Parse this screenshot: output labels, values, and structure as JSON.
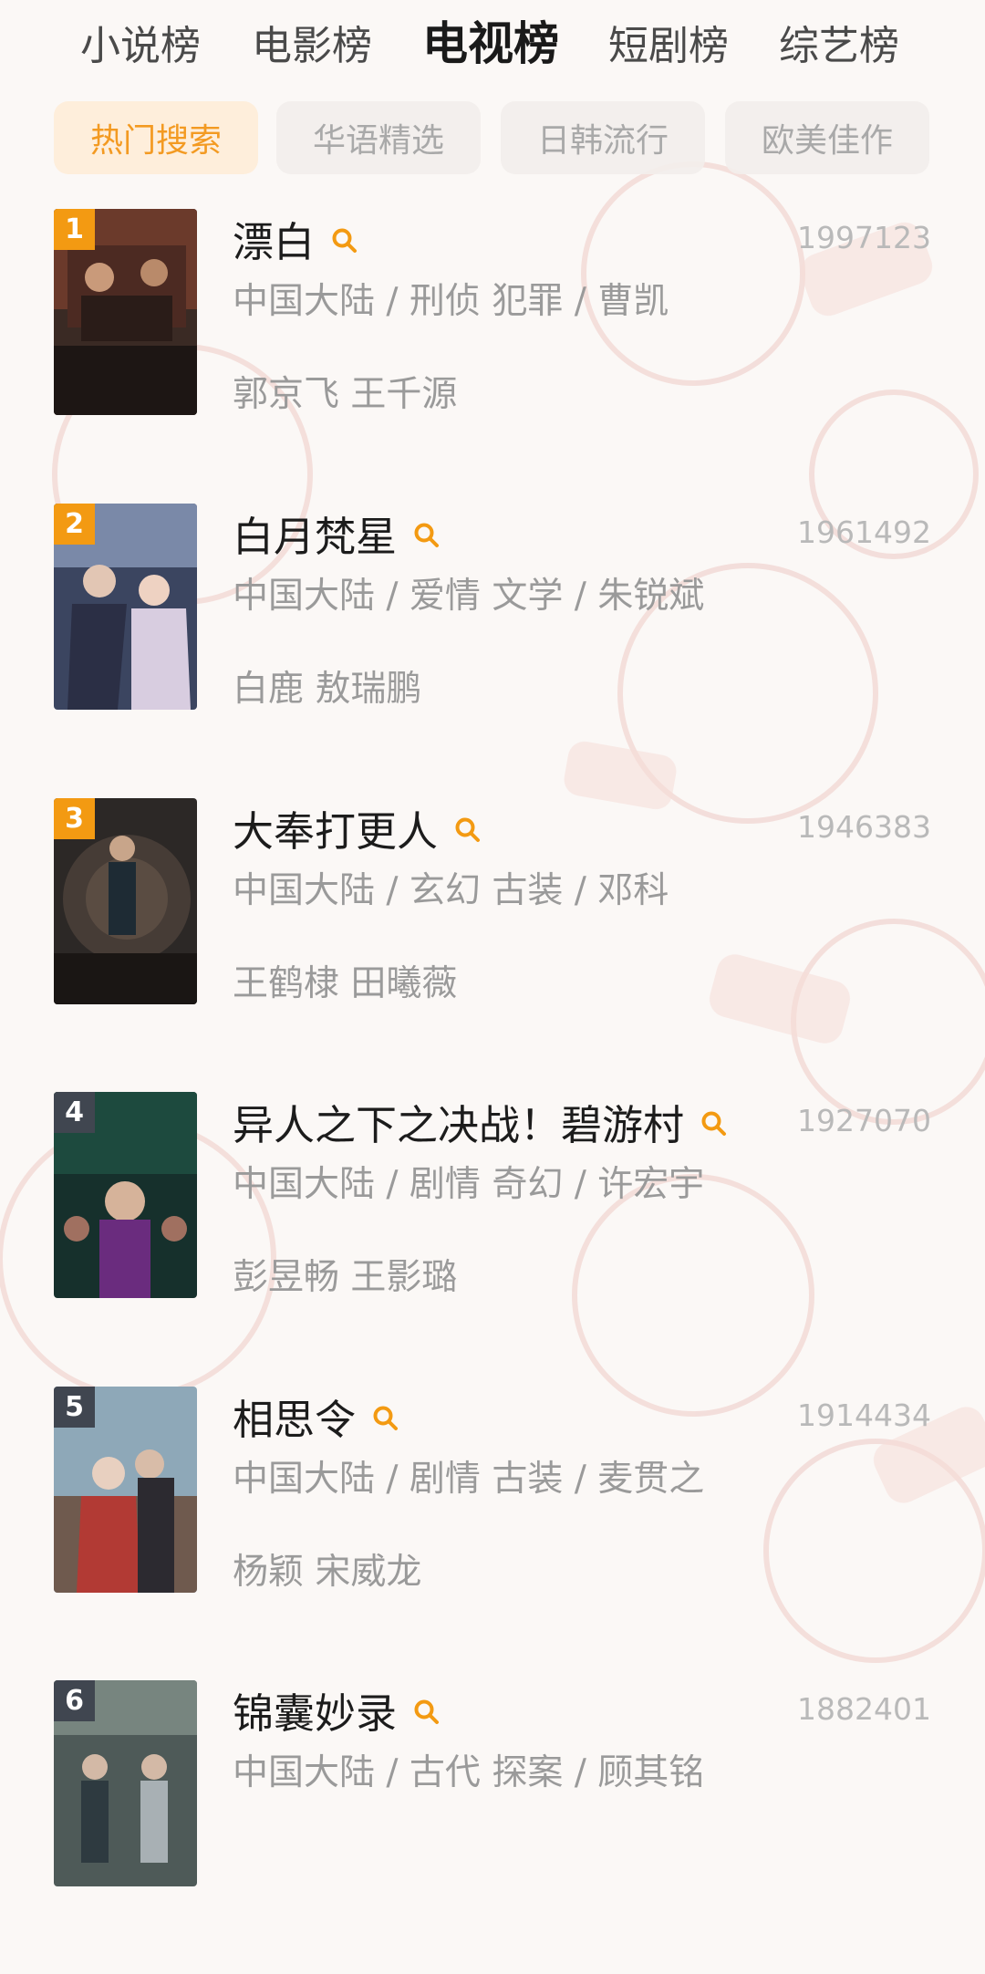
{
  "top_tabs": [
    {
      "label": "小说榜",
      "active": false
    },
    {
      "label": "电影榜",
      "active": false
    },
    {
      "label": "电视榜",
      "active": true
    },
    {
      "label": "短剧榜",
      "active": false
    },
    {
      "label": "综艺榜",
      "active": false
    }
  ],
  "sub_tabs": [
    {
      "label": "热门搜索",
      "active": true
    },
    {
      "label": "华语精选",
      "active": false
    },
    {
      "label": "日韩流行",
      "active": false
    },
    {
      "label": "欧美佳作",
      "active": false
    }
  ],
  "colors": {
    "accent": "#f39a12",
    "accent_text": "#f39a22",
    "rank_dark": "#404650"
  },
  "search_icon": "search-icon",
  "items": [
    {
      "rank": "1",
      "title": "漂白",
      "score": "1997123",
      "meta": "中国大陆 / 刑侦 犯罪 / 曹凯",
      "cast": "郭京飞 王千源",
      "poster_title": "漂白"
    },
    {
      "rank": "2",
      "title": "白月梵星",
      "score": "1961492",
      "meta": "中国大陆 / 爱情 文学 / 朱锐斌",
      "cast": "白鹿 敖瑞鹏",
      "poster_title": "白月梵星"
    },
    {
      "rank": "3",
      "title": "大奉打更人",
      "score": "1946383",
      "meta": "中国大陆 / 玄幻 古装 / 邓科",
      "cast": "王鹤棣 田曦薇",
      "poster_title": "大奉打更人"
    },
    {
      "rank": "4",
      "title": "异人之下之决战！碧游村",
      "score": "1927070",
      "meta": "中国大陆 / 剧情 奇幻 / 许宏宇",
      "cast": "彭昱畅 王影璐",
      "poster_title": "异人之下"
    },
    {
      "rank": "5",
      "title": "相思令",
      "score": "1914434",
      "meta": "中国大陆 / 剧情 古装 / 麦贯之",
      "cast": "杨颖 宋威龙",
      "poster_title": "相思令"
    },
    {
      "rank": "6",
      "title": "锦囊妙录",
      "score": "1882401",
      "meta": "中国大陆 / 古代 探案 / 顾其铭",
      "cast": "",
      "poster_title": "锦囊妙录"
    }
  ]
}
